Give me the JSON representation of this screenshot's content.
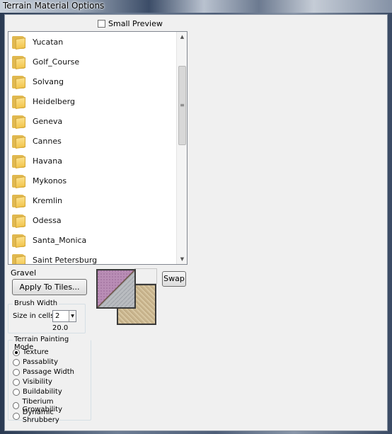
{
  "window": {
    "title": "Terrain Material Options"
  },
  "options": {
    "small_preview_label": "Small Preview",
    "small_preview_checked": false
  },
  "folders": [
    {
      "label": "Yucatan"
    },
    {
      "label": "Golf_Course"
    },
    {
      "label": "Solvang"
    },
    {
      "label": "Heidelberg"
    },
    {
      "label": "Geneva"
    },
    {
      "label": "Cannes"
    },
    {
      "label": "Havana"
    },
    {
      "label": "Mykonos"
    },
    {
      "label": "Kremlin"
    },
    {
      "label": "Odessa"
    },
    {
      "label": "Santa_Monica"
    },
    {
      "label": "Saint Petersburg"
    }
  ],
  "material": {
    "name": "Gravel",
    "apply_label": "Apply To Tiles...",
    "swap_label": "Swap"
  },
  "brush": {
    "group_title": "Brush Width",
    "size_label": "Size in cells:",
    "size_value": "2",
    "width_value": "20.0"
  },
  "mode": {
    "group_title": "Terrain Painting Mode",
    "selected": "Texture",
    "options": [
      {
        "label": "Texture"
      },
      {
        "label": "Passablity"
      },
      {
        "label": "Passage Width"
      },
      {
        "label": "Visibility"
      },
      {
        "label": "Buildability"
      },
      {
        "label": "Tiberium Growability"
      },
      {
        "label": "Dynamic Shrubbery"
      }
    ]
  },
  "colors": {
    "swatch_purple": "#b98db5",
    "swatch_grey": "#b9bcc0",
    "swatch_sand": "#cdb891"
  }
}
